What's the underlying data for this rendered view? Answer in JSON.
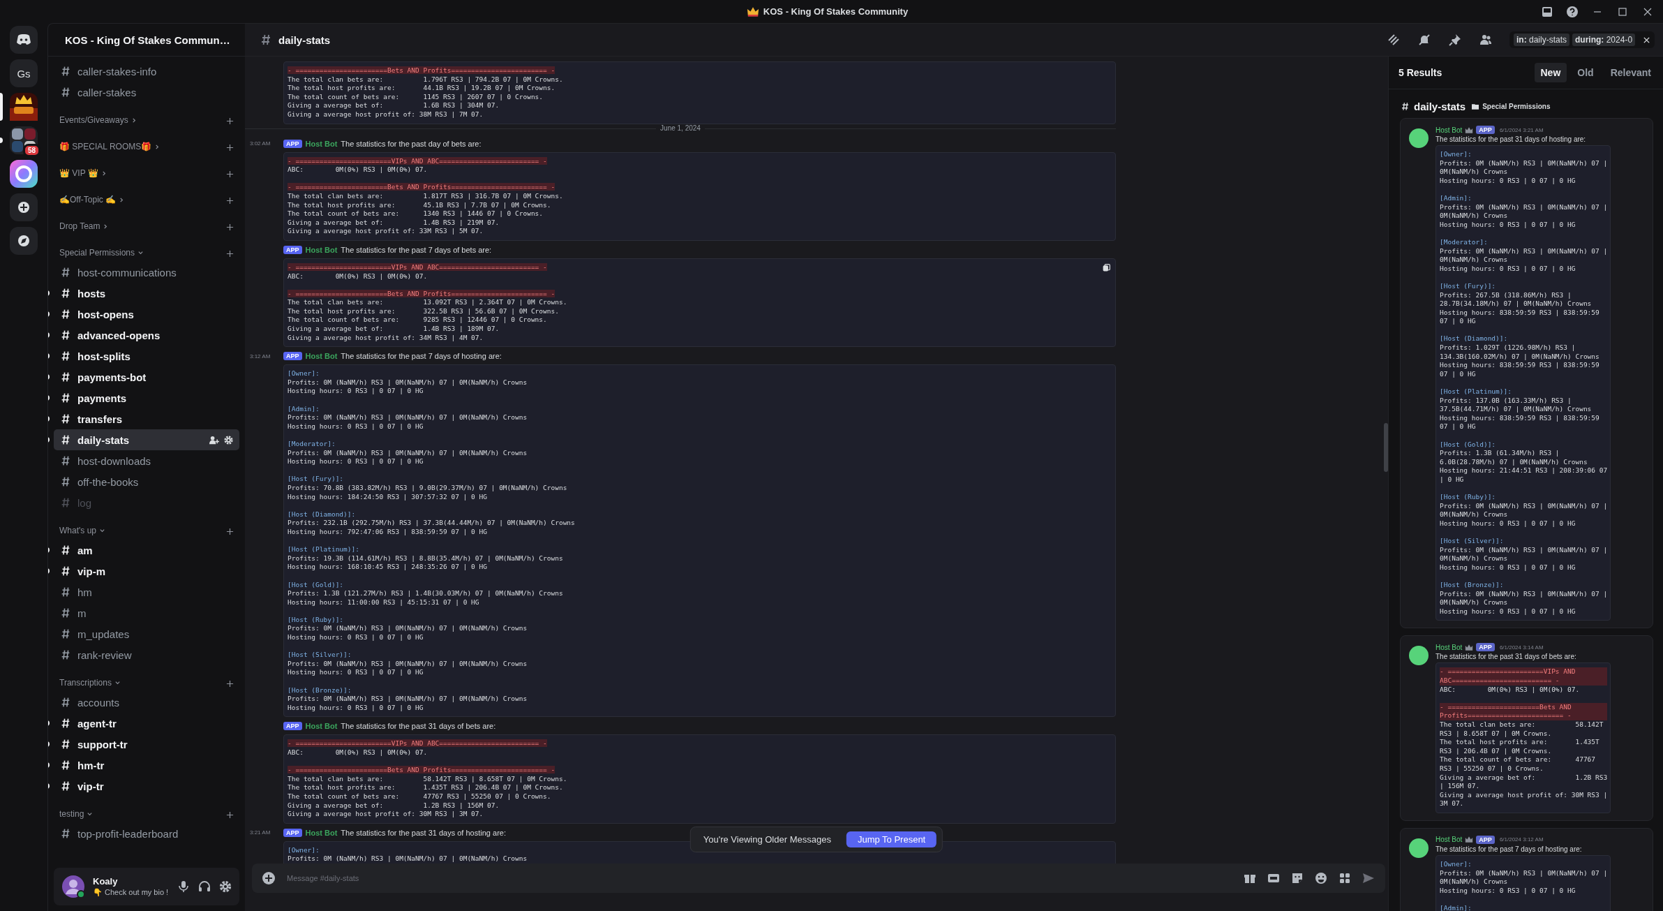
{
  "window": {
    "title": "KOS - King Of Stakes Community"
  },
  "servers": [
    {
      "kind": "home",
      "selected": false,
      "unread": false
    },
    {
      "kind": "text",
      "label": "Gs",
      "selected": false,
      "unread": false
    },
    {
      "kind": "picture",
      "selected": true,
      "unread": false
    },
    {
      "kind": "folder",
      "badge": "58",
      "selected": false,
      "unread": true
    },
    {
      "kind": "app",
      "selected": false,
      "unread": false
    },
    {
      "kind": "add",
      "selected": false,
      "unread": false
    },
    {
      "kind": "discover",
      "selected": false,
      "unread": false
    }
  ],
  "sidebar": {
    "server_name": "KOS - King Of Stakes Commun…",
    "channels": [
      {
        "name": "caller-stakes-info",
        "unread": false,
        "muted": false,
        "selected": false
      },
      {
        "name": "caller-stakes",
        "unread": false,
        "muted": false,
        "selected": false
      }
    ],
    "categories": [
      {
        "name": "Events/Giveaways",
        "expanded": false
      },
      {
        "name": "🎁 SPECIAL ROOMS🎁",
        "expanded": false
      },
      {
        "name": "👑 VIP 👑",
        "expanded": false
      },
      {
        "name": "✍️Off-Topic ✍️",
        "expanded": false
      },
      {
        "name": "Drop Team",
        "expanded": false
      },
      {
        "name": "Special Permissions",
        "expanded": true,
        "channels": [
          {
            "name": "host-communications",
            "unread": false,
            "muted": false,
            "selected": false
          },
          {
            "name": "hosts",
            "unread": true,
            "muted": false,
            "selected": false
          },
          {
            "name": "host-opens",
            "unread": true,
            "muted": false,
            "selected": false
          },
          {
            "name": "advanced-opens",
            "unread": true,
            "muted": false,
            "selected": false
          },
          {
            "name": "host-splits",
            "unread": true,
            "muted": false,
            "selected": false
          },
          {
            "name": "payments-bot",
            "unread": true,
            "muted": false,
            "selected": false
          },
          {
            "name": "payments",
            "unread": true,
            "muted": false,
            "selected": false
          },
          {
            "name": "transfers",
            "unread": true,
            "muted": false,
            "selected": false
          },
          {
            "name": "daily-stats",
            "unread": true,
            "muted": false,
            "selected": true
          },
          {
            "name": "host-downloads",
            "unread": false,
            "muted": false,
            "selected": false
          },
          {
            "name": "off-the-books",
            "unread": false,
            "muted": false,
            "selected": false
          },
          {
            "name": "log",
            "unread": false,
            "muted": true,
            "selected": false
          }
        ]
      },
      {
        "name": "What's up",
        "expanded": true,
        "channels": [
          {
            "name": "am",
            "unread": true,
            "muted": false,
            "selected": false
          },
          {
            "name": "vip-m",
            "unread": true,
            "muted": false,
            "selected": false
          },
          {
            "name": "hm",
            "unread": false,
            "muted": false,
            "selected": false
          },
          {
            "name": "m",
            "unread": false,
            "muted": false,
            "selected": false
          },
          {
            "name": "m_updates",
            "unread": false,
            "muted": false,
            "selected": false
          },
          {
            "name": "rank-review",
            "unread": false,
            "muted": false,
            "selected": false
          }
        ]
      },
      {
        "name": "Transcriptions",
        "expanded": true,
        "channels": [
          {
            "name": "accounts",
            "unread": false,
            "muted": false,
            "selected": false
          },
          {
            "name": "agent-tr",
            "unread": true,
            "muted": false,
            "selected": false
          },
          {
            "name": "support-tr",
            "unread": true,
            "muted": false,
            "selected": false
          },
          {
            "name": "hm-tr",
            "unread": true,
            "muted": false,
            "selected": false
          },
          {
            "name": "vip-tr",
            "unread": true,
            "muted": false,
            "selected": false
          }
        ]
      },
      {
        "name": "testing",
        "expanded": true,
        "channels": [
          {
            "name": "top-profit-leaderboard",
            "unread": false,
            "muted": false,
            "selected": false
          }
        ]
      }
    ]
  },
  "user": {
    "name": "Koaly",
    "status": "👇 Check out my bio !"
  },
  "header": {
    "channel": "daily-stats",
    "filters": [
      {
        "key": "in:",
        "value": "daily-stats"
      },
      {
        "key": "during:",
        "value": "2024-0"
      }
    ]
  },
  "chat": {
    "items": [
      {
        "kind": "block",
        "lines": [
          {
            "kind": "head",
            "text": "- =======================Bets AND Profits======================== -"
          },
          {
            "kind": "text",
            "text": "The total clan bets are:          1.796T RS3 | 794.2B 07 | 0M Crowns."
          },
          {
            "kind": "text",
            "text": "The total host profits are:       44.1B RS3 | 19.2B 07 | 0M Crowns."
          },
          {
            "kind": "text",
            "text": "The total count of bets are:      1145 RS3 | 2607 07 | 0 Crowns."
          },
          {
            "kind": "text",
            "text": "Giving a average bet of:          1.6B RS3 | 304M 07."
          },
          {
            "kind": "text",
            "text": "Giving a average host profit of: 38M RS3 | 7M 07."
          }
        ]
      },
      {
        "kind": "divider",
        "label": "June 1, 2024"
      },
      {
        "kind": "message",
        "time": "3:02 AM",
        "author": "Host Bot",
        "badge": "APP",
        "text": "The statistics for the past day of bets are:",
        "hovered": false,
        "lines": [
          {
            "kind": "head",
            "text": "- ========================VIPs AND ABC========================= -"
          },
          {
            "kind": "text",
            "text": "ABC:        0M(0%) RS3 | 0M(0%) 07."
          },
          {
            "kind": "gap"
          },
          {
            "kind": "head",
            "text": "- =======================Bets AND Profits======================== -"
          },
          {
            "kind": "text",
            "text": "The total clan bets are:          1.817T RS3 | 316.7B 07 | 0M Crowns."
          },
          {
            "kind": "text",
            "text": "The total host profits are:       45.1B RS3 | 7.7B 07 | 0M Crowns."
          },
          {
            "kind": "text",
            "text": "The total count of bets are:      1340 RS3 | 1446 07 | 0 Crowns."
          },
          {
            "kind": "text",
            "text": "Giving a average bet of:          1.4B RS3 | 219M 07."
          },
          {
            "kind": "text",
            "text": "Giving a average host profit of: 33M RS3 | 5M 07."
          }
        ]
      },
      {
        "kind": "message",
        "author": "Host Bot",
        "badge": "APP",
        "text": "The statistics for the past 7 days of bets are:",
        "hovered": true,
        "lines": [
          {
            "kind": "head",
            "text": "- ========================VIPs AND ABC========================= -"
          },
          {
            "kind": "text",
            "text": "ABC:        0M(0%) RS3 | 0M(0%) 07."
          },
          {
            "kind": "gap"
          },
          {
            "kind": "head",
            "text": "- =======================Bets AND Profits======================== -"
          },
          {
            "kind": "text",
            "text": "The total clan bets are:          13.092T RS3 | 2.364T 07 | 0M Crowns."
          },
          {
            "kind": "text",
            "text": "The total host profits are:       322.5B RS3 | 56.6B 07 | 0M Crowns."
          },
          {
            "kind": "text",
            "text": "The total count of bets are:      9285 RS3 | 12446 07 | 0 Crowns."
          },
          {
            "kind": "text",
            "text": "Giving a average bet of:          1.4B RS3 | 189M 07."
          },
          {
            "kind": "text",
            "text": "Giving a average host profit of: 34M RS3 | 4M 07."
          }
        ]
      },
      {
        "kind": "message",
        "time": "3:12 AM",
        "author": "Host Bot",
        "badge": "APP",
        "text": "The statistics for the past 7 days of hosting are:",
        "hovered": false,
        "lines": [
          {
            "kind": "role",
            "text": "[Owner]:"
          },
          {
            "kind": "text",
            "text": "Profits: 0M (NaNM/h) RS3 | 0M(NaNM/h) 07 | 0M(NaNM/h) Crowns"
          },
          {
            "kind": "text",
            "text": "Hosting hours: 0 RS3 | 0 07 | 0 HG"
          },
          {
            "kind": "gap"
          },
          {
            "kind": "role",
            "text": "[Admin]:"
          },
          {
            "kind": "text",
            "text": "Profits: 0M (NaNM/h) RS3 | 0M(NaNM/h) 07 | 0M(NaNM/h) Crowns"
          },
          {
            "kind": "text",
            "text": "Hosting hours: 0 RS3 | 0 07 | 0 HG"
          },
          {
            "kind": "gap"
          },
          {
            "kind": "role",
            "text": "[Moderator]:"
          },
          {
            "kind": "text",
            "text": "Profits: 0M (NaNM/h) RS3 | 0M(NaNM/h) 07 | 0M(NaNM/h) Crowns"
          },
          {
            "kind": "text",
            "text": "Hosting hours: 0 RS3 | 0 07 | 0 HG"
          },
          {
            "kind": "gap"
          },
          {
            "kind": "role",
            "text": "[Host (Fury)]:"
          },
          {
            "kind": "text",
            "text": "Profits: 70.8B (383.82M/h) RS3 | 9.0B(29.37M/h) 07 | 0M(NaNM/h) Crowns"
          },
          {
            "kind": "text",
            "text": "Hosting hours: 184:24:50 RS3 | 307:57:32 07 | 0 HG"
          },
          {
            "kind": "gap"
          },
          {
            "kind": "role",
            "text": "[Host (Diamond)]:"
          },
          {
            "kind": "text",
            "text": "Profits: 232.1B (292.75M/h) RS3 | 37.3B(44.44M/h) 07 | 0M(NaNM/h) Crowns"
          },
          {
            "kind": "text",
            "text": "Hosting hours: 792:47:06 RS3 | 838:59:59 07 | 0 HG"
          },
          {
            "kind": "gap"
          },
          {
            "kind": "role",
            "text": "[Host (Platinum)]:"
          },
          {
            "kind": "text",
            "text": "Profits: 19.3B (114.61M/h) RS3 | 8.8B(35.4M/h) 07 | 0M(NaNM/h) Crowns"
          },
          {
            "kind": "text",
            "text": "Hosting hours: 168:10:45 RS3 | 248:35:26 07 | 0 HG"
          },
          {
            "kind": "gap"
          },
          {
            "kind": "role",
            "text": "[Host (Gold)]:"
          },
          {
            "kind": "text",
            "text": "Profits: 1.3B (121.27M/h) RS3 | 1.4B(30.03M/h) 07 | 0M(NaNM/h) Crowns"
          },
          {
            "kind": "text",
            "text": "Hosting hours: 11:00:00 RS3 | 45:15:31 07 | 0 HG"
          },
          {
            "kind": "gap"
          },
          {
            "kind": "role",
            "text": "[Host (Ruby)]:"
          },
          {
            "kind": "text",
            "text": "Profits: 0M (NaNM/h) RS3 | 0M(NaNM/h) 07 | 0M(NaNM/h) Crowns"
          },
          {
            "kind": "text",
            "text": "Hosting hours: 0 RS3 | 0 07 | 0 HG"
          },
          {
            "kind": "gap"
          },
          {
            "kind": "role",
            "text": "[Host (Silver)]:"
          },
          {
            "kind": "text",
            "text": "Profits: 0M (NaNM/h) RS3 | 0M(NaNM/h) 07 | 0M(NaNM/h) Crowns"
          },
          {
            "kind": "text",
            "text": "Hosting hours: 0 RS3 | 0 07 | 0 HG"
          },
          {
            "kind": "gap"
          },
          {
            "kind": "role",
            "text": "[Host (Bronze)]:"
          },
          {
            "kind": "text",
            "text": "Profits: 0M (NaNM/h) RS3 | 0M(NaNM/h) 07 | 0M(NaNM/h) Crowns"
          },
          {
            "kind": "text",
            "text": "Hosting hours: 0 RS3 | 0 07 | 0 HG"
          }
        ]
      },
      {
        "kind": "message",
        "author": "Host Bot",
        "badge": "APP",
        "text": "The statistics for the past 31 days of bets are:",
        "hovered": false,
        "lines": [
          {
            "kind": "head",
            "text": "- ========================VIPs AND ABC========================= -"
          },
          {
            "kind": "text",
            "text": "ABC:        0M(0%) RS3 | 0M(0%) 07."
          },
          {
            "kind": "gap"
          },
          {
            "kind": "head",
            "text": "- =======================Bets AND Profits======================== -"
          },
          {
            "kind": "text",
            "text": "The total clan bets are:          58.142T RS3 | 8.658T 07 | 0M Crowns."
          },
          {
            "kind": "text",
            "text": "The total host profits are:       1.435T RS3 | 206.4B 07 | 0M Crowns."
          },
          {
            "kind": "text",
            "text": "The total count of bets are:      47767 RS3 | 55250 07 | 0 Crowns."
          },
          {
            "kind": "text",
            "text": "Giving a average bet of:          1.2B RS3 | 156M 07."
          },
          {
            "kind": "text",
            "text": "Giving a average host profit of: 30M RS3 | 3M 07."
          }
        ]
      },
      {
        "kind": "message",
        "time": "3:21 AM",
        "author": "Host Bot",
        "badge": "APP",
        "text": "The statistics for the past 31 days of hosting are:",
        "hovered": false,
        "lines": [
          {
            "kind": "role",
            "text": "[Owner]:"
          },
          {
            "kind": "text",
            "text": "Profits: 0M (NaNM/h) RS3 | 0M(NaNM/h) 07 | 0M(NaNM/h) Crowns"
          }
        ]
      }
    ],
    "notice": {
      "text": "You're Viewing Older Messages",
      "action": "Jump To Present"
    },
    "composer": {
      "placeholder": "Message #daily-stats"
    }
  },
  "results": {
    "count": "5 Results",
    "sorts": [
      {
        "label": "New",
        "selected": true
      },
      {
        "label": "Old",
        "selected": false
      },
      {
        "label": "Relevant",
        "selected": false
      }
    ],
    "group": {
      "channel": "daily-stats",
      "category": "Special Permissions"
    },
    "cards": [
      {
        "author": "Host Bot",
        "badge": "APP",
        "time": "6/1/2024 3:21 AM",
        "text": "The statistics for the past 31 days of hosting are:",
        "lines": [
          {
            "kind": "role",
            "text": "[Owner]:"
          },
          {
            "kind": "text",
            "text": "Profits: 0M (NaNM/h) RS3 | 0M(NaNM/h) 07 | 0M(NaNM/h) Crowns"
          },
          {
            "kind": "text",
            "text": "Hosting hours: 0 RS3 | 0 07 | 0 HG"
          },
          {
            "kind": "gap"
          },
          {
            "kind": "role",
            "text": "[Admin]:"
          },
          {
            "kind": "text",
            "text": "Profits: 0M (NaNM/h) RS3 | 0M(NaNM/h) 07 | 0M(NaNM/h) Crowns"
          },
          {
            "kind": "text",
            "text": "Hosting hours: 0 RS3 | 0 07 | 0 HG"
          },
          {
            "kind": "gap"
          },
          {
            "kind": "role",
            "text": "[Moderator]:"
          },
          {
            "kind": "text",
            "text": "Profits: 0M (NaNM/h) RS3 | 0M(NaNM/h) 07 | 0M(NaNM/h) Crowns"
          },
          {
            "kind": "text",
            "text": "Hosting hours: 0 RS3 | 0 07 | 0 HG"
          },
          {
            "kind": "gap"
          },
          {
            "kind": "role",
            "text": "[Host (Fury)]:"
          },
          {
            "kind": "text",
            "text": "Profits: 267.5B (318.86M/h) RS3 | 28.7B(34.18M/h) 07 | 0M(NaNM/h) Crowns"
          },
          {
            "kind": "text",
            "text": "Hosting hours: 838:59:59 RS3 | 838:59:59 07 | 0 HG"
          },
          {
            "kind": "gap"
          },
          {
            "kind": "role",
            "text": "[Host (Diamond)]:"
          },
          {
            "kind": "text",
            "text": "Profits: 1.029T (1226.98M/h) RS3 | 134.3B(160.02M/h) 07 | 0M(NaNM/h) Crowns"
          },
          {
            "kind": "text",
            "text": "Hosting hours: 838:59:59 RS3 | 838:59:59 07 | 0 HG"
          },
          {
            "kind": "gap"
          },
          {
            "kind": "role",
            "text": "[Host (Platinum)]:"
          },
          {
            "kind": "text",
            "text": "Profits: 137.0B (163.33M/h) RS3 | 37.5B(44.71M/h) 07 | 0M(NaNM/h) Crowns"
          },
          {
            "kind": "text",
            "text": "Hosting hours: 838:59:59 RS3 | 838:59:59 07 | 0 HG"
          },
          {
            "kind": "gap"
          },
          {
            "kind": "role",
            "text": "[Host (Gold)]:"
          },
          {
            "kind": "text",
            "text": "Profits: 1.3B (61.34M/h) RS3 | 6.0B(28.78M/h) 07 | 0M(NaNM/h) Crowns"
          },
          {
            "kind": "text",
            "text": "Hosting hours: 21:44:51 RS3 | 208:39:06 07 | 0 HG"
          },
          {
            "kind": "gap"
          },
          {
            "kind": "role",
            "text": "[Host (Ruby)]:"
          },
          {
            "kind": "text",
            "text": "Profits: 0M (NaNM/h) RS3 | 0M(NaNM/h) 07 | 0M(NaNM/h) Crowns"
          },
          {
            "kind": "text",
            "text": "Hosting hours: 0 RS3 | 0 07 | 0 HG"
          },
          {
            "kind": "gap"
          },
          {
            "kind": "role",
            "text": "[Host (Silver)]:"
          },
          {
            "kind": "text",
            "text": "Profits: 0M (NaNM/h) RS3 | 0M(NaNM/h) 07 | 0M(NaNM/h) Crowns"
          },
          {
            "kind": "text",
            "text": "Hosting hours: 0 RS3 | 0 07 | 0 HG"
          },
          {
            "kind": "gap"
          },
          {
            "kind": "role",
            "text": "[Host (Bronze)]:"
          },
          {
            "kind": "text",
            "text": "Profits: 0M (NaNM/h) RS3 | 0M(NaNM/h) 07 | 0M(NaNM/h) Crowns"
          },
          {
            "kind": "text",
            "text": "Hosting hours: 0 RS3 | 0 07 | 0 HG"
          }
        ]
      },
      {
        "author": "Host Bot",
        "badge": "APP",
        "time": "6/1/2024 3:14 AM",
        "text": "The statistics for the past 31 days of bets are:",
        "lines": [
          {
            "kind": "head",
            "text": "- ========================VIPs AND ABC========================= -"
          },
          {
            "kind": "text",
            "text": "ABC:        0M(0%) RS3 | 0M(0%) 07."
          },
          {
            "kind": "gap"
          },
          {
            "kind": "head",
            "text": "- =======================Bets AND Profits======================== -"
          },
          {
            "kind": "text",
            "text": "The total clan bets are:          58.142T RS3 | 8.658T 07 | 0M Crowns."
          },
          {
            "kind": "text",
            "text": "The total host profits are:       1.435T RS3 | 206.4B 07 | 0M Crowns."
          },
          {
            "kind": "text",
            "text": "The total count of bets are:      47767 RS3 | 55250 07 | 0 Crowns."
          },
          {
            "kind": "text",
            "text": "Giving a average bet of:          1.2B RS3 | 156M 07."
          },
          {
            "kind": "text",
            "text": "Giving a average host profit of: 30M RS3 | 3M 07."
          }
        ]
      },
      {
        "author": "Host Bot",
        "badge": "APP",
        "time": "6/1/2024 3:12 AM",
        "text": "The statistics for the past 7 days of hosting are:",
        "lines": [
          {
            "kind": "role",
            "text": "[Owner]:"
          },
          {
            "kind": "text",
            "text": "Profits: 0M (NaNM/h) RS3 | 0M(NaNM/h) 07 | 0M(NaNM/h) Crowns"
          },
          {
            "kind": "text",
            "text": "Hosting hours: 0 RS3 | 0 07 | 0 HG"
          },
          {
            "kind": "gap"
          },
          {
            "kind": "role",
            "text": "[Admin]:"
          }
        ]
      }
    ]
  }
}
